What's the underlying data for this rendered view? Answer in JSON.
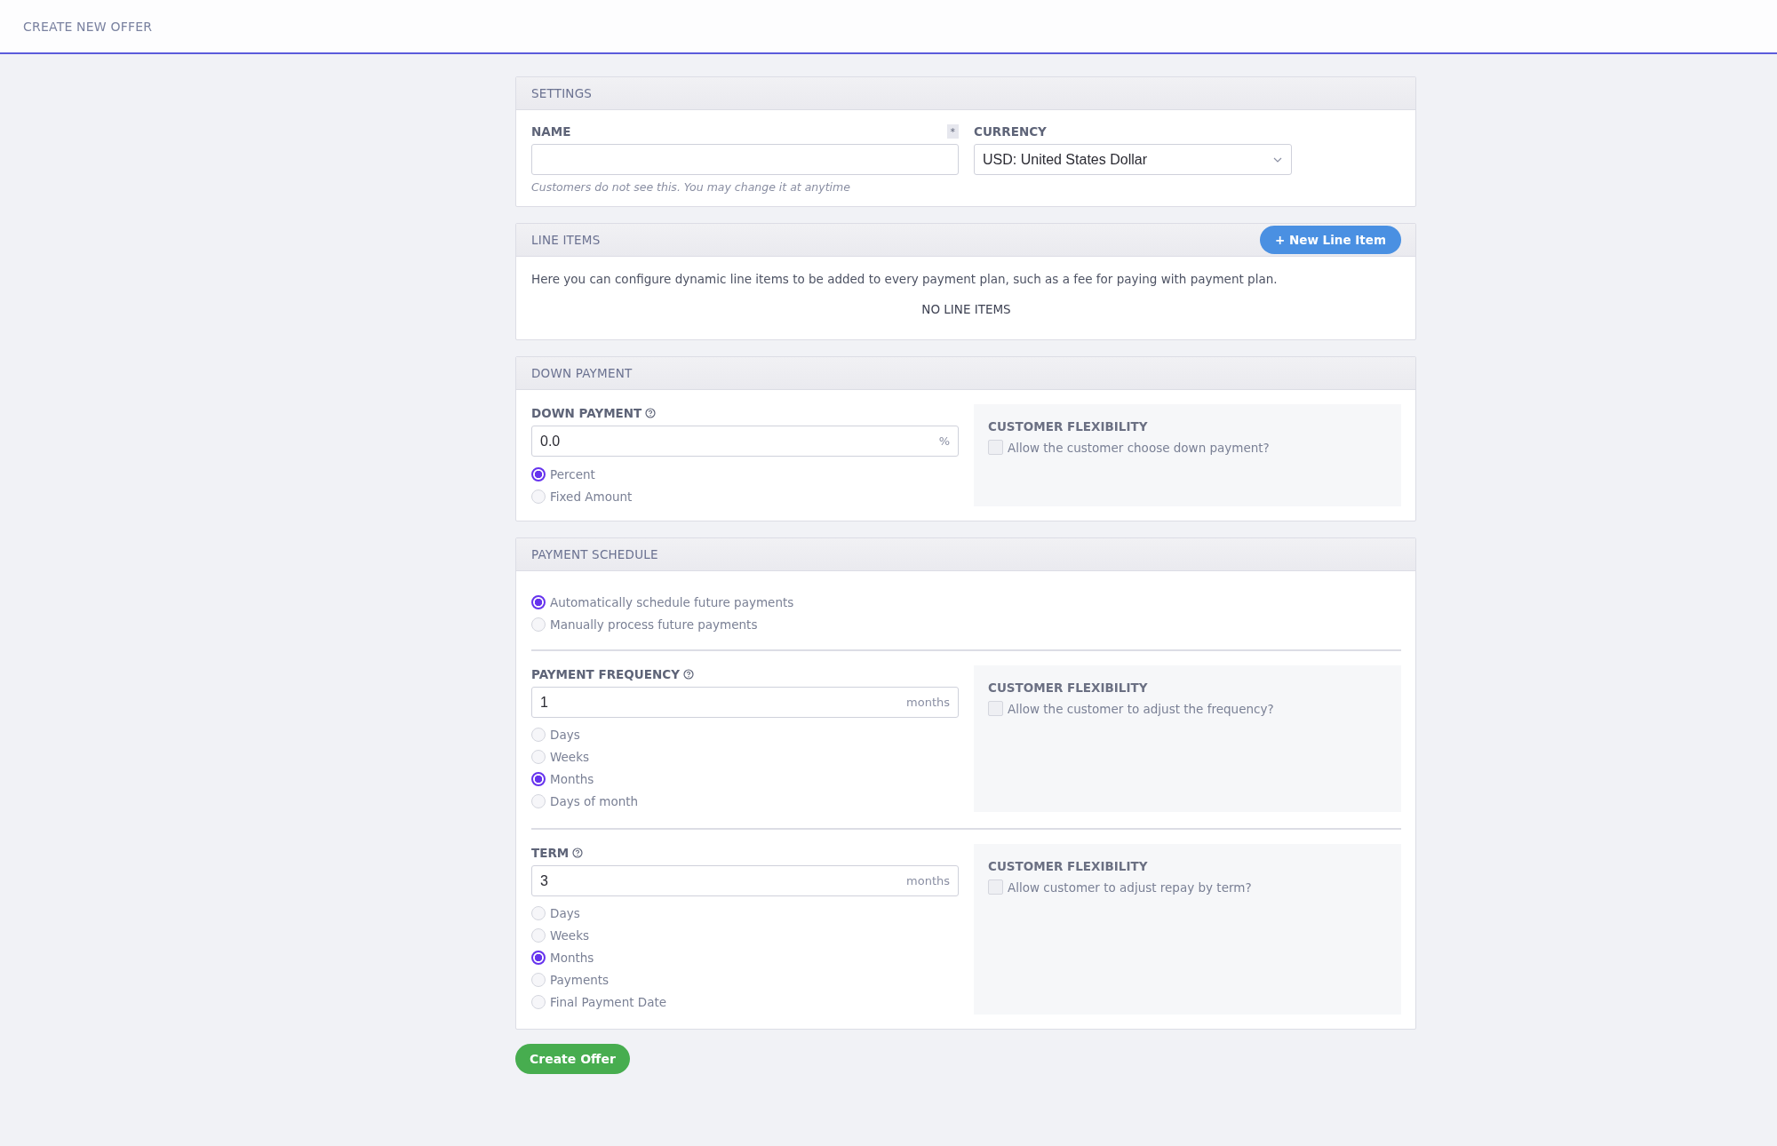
{
  "header": {
    "title": "CREATE NEW OFFER"
  },
  "settings": {
    "title": "SETTINGS",
    "name_field": {
      "label": "NAME",
      "required_mark": "*",
      "hint": "Customers do not see this. You may change it at anytime"
    },
    "currency_field": {
      "label": "CURRENCY",
      "value": "USD: United States Dollar"
    }
  },
  "line_items": {
    "title": "LINE ITEMS",
    "button": "+ New Line Item",
    "description": "Here you can configure dynamic line items to be added to every payment plan, such as a fee for paying with payment plan.",
    "empty_text": "NO LINE ITEMS"
  },
  "down_payment": {
    "title": "DOWN PAYMENT",
    "field": {
      "label": "DOWN PAYMENT",
      "value": "0.0",
      "suffix": "%"
    },
    "options": [
      {
        "label": "Percent",
        "selected": true
      },
      {
        "label": "Fixed Amount",
        "selected": false
      }
    ],
    "flexibility": {
      "title": "CUSTOMER FLEXIBILITY",
      "checkbox": {
        "label": "Allow the customer choose down payment?",
        "checked": false
      }
    }
  },
  "payment_schedule": {
    "title": "PAYMENT SCHEDULE",
    "modes": [
      {
        "label": "Automatically schedule future payments",
        "selected": true
      },
      {
        "label": "Manually process future payments",
        "selected": false
      }
    ],
    "sections": [
      {
        "label": "PAYMENT FREQUENCY",
        "value": "1",
        "suffix": "months",
        "options": [
          {
            "label": "Days",
            "selected": false
          },
          {
            "label": "Weeks",
            "selected": false
          },
          {
            "label": "Months",
            "selected": true
          },
          {
            "label": "Days of month",
            "selected": false
          }
        ],
        "flexibility": {
          "title": "CUSTOMER FLEXIBILITY",
          "checkbox": {
            "label": "Allow the customer to adjust the frequency?",
            "checked": false
          }
        }
      },
      {
        "label": "TERM",
        "value": "3",
        "suffix": "months",
        "options": [
          {
            "label": "Days",
            "selected": false
          },
          {
            "label": "Weeks",
            "selected": false
          },
          {
            "label": "Months",
            "selected": true
          },
          {
            "label": "Payments",
            "selected": false
          },
          {
            "label": "Final Payment Date",
            "selected": false
          }
        ],
        "flexibility": {
          "title": "CUSTOMER FLEXIBILITY",
          "checkbox": {
            "label": "Allow customer to adjust repay by term?",
            "checked": false
          }
        }
      }
    ]
  },
  "submit_button": "Create Offer"
}
